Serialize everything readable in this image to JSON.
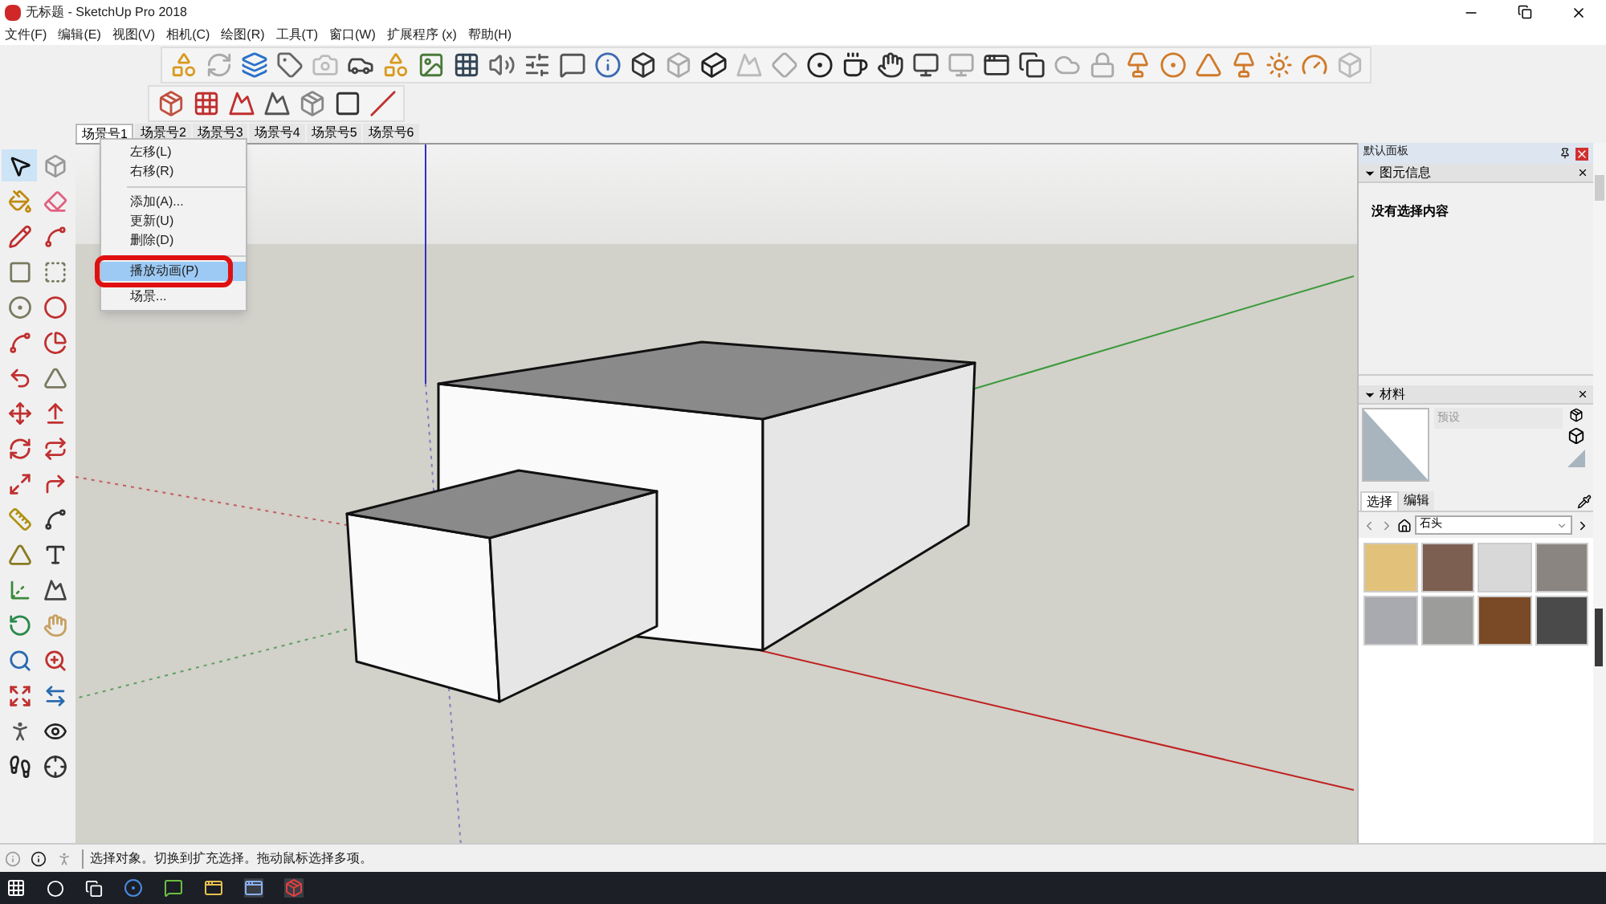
{
  "window": {
    "title": "无标题 - SketchUp Pro 2018"
  },
  "menu_bar": [
    "文件(F)",
    "编辑(E)",
    "视图(V)",
    "相机(C)",
    "绘图(R)",
    "工具(T)",
    "窗口(W)",
    "扩展程序 (x)",
    "帮助(H)"
  ],
  "scene_tabs": [
    {
      "label": "场景号1",
      "selected": true
    },
    {
      "label": "场景号2",
      "selected": false
    },
    {
      "label": "场景号3",
      "selected": false
    },
    {
      "label": "场景号4",
      "selected": false
    },
    {
      "label": "场景号5",
      "selected": false
    },
    {
      "label": "场景号6",
      "selected": false
    }
  ],
  "context_menu": {
    "items": [
      {
        "kind": "item",
        "label": "左移(L)",
        "highlighted": false
      },
      {
        "kind": "item",
        "label": "右移(R)",
        "highlighted": false
      },
      {
        "kind": "separator"
      },
      {
        "kind": "item",
        "label": "添加(A)...",
        "highlighted": false
      },
      {
        "kind": "item",
        "label": "更新(U)",
        "highlighted": false
      },
      {
        "kind": "item",
        "label": "删除(D)",
        "highlighted": false
      },
      {
        "kind": "separator"
      },
      {
        "kind": "item",
        "label": "播放动画(P)",
        "highlighted": true
      },
      {
        "kind": "item",
        "label": "场景...",
        "highlighted": false
      }
    ]
  },
  "tools": [
    {
      "selected": true
    },
    {
      "selected": false
    },
    {
      "selected": false
    },
    {
      "selected": false
    },
    {
      "selected": false
    },
    {
      "selected": false
    },
    {
      "selected": false
    },
    {
      "selected": false
    },
    {
      "selected": false
    },
    {
      "selected": false
    },
    {
      "selected": false
    },
    {
      "selected": false
    },
    {
      "selected": false
    },
    {
      "selected": false
    },
    {
      "selected": false
    },
    {
      "selected": false
    },
    {
      "selected": false
    },
    {
      "selected": false
    },
    {
      "selected": false
    },
    {
      "selected": false
    },
    {
      "selected": false
    },
    {
      "selected": false
    },
    {
      "selected": false
    },
    {
      "selected": false
    },
    {
      "selected": false
    },
    {
      "selected": false
    },
    {
      "selected": false
    },
    {
      "selected": false
    },
    {
      "selected": false
    },
    {
      "selected": false
    },
    {
      "selected": false
    },
    {
      "selected": false
    },
    {
      "selected": false
    },
    {
      "selected": false
    },
    {
      "selected": false
    },
    {
      "selected": false
    }
  ],
  "tray": {
    "title": "默认面板",
    "entity_info": {
      "title": "图元信息",
      "expanded": true,
      "text": "没有选择内容"
    },
    "materials": {
      "title": "材料",
      "expanded": true,
      "name_placeholder": "预设",
      "tabs": [
        {
          "label": "选择",
          "selected": true
        },
        {
          "label": "编辑",
          "selected": false
        }
      ],
      "collection": "石头",
      "swatches": [
        {
          "color": "#e2c27a"
        },
        {
          "color": "#7d5f52"
        },
        {
          "color": "#d8d8d8"
        },
        {
          "color": "#8a8580"
        },
        {
          "color": "#a9aab0"
        },
        {
          "color": "#9c9c9a"
        },
        {
          "color": "#7a4a26"
        },
        {
          "color": "#4a4a4a"
        }
      ]
    }
  },
  "status_bar": {
    "text": "选择对象。切换到扩充选择。拖动鼠标选择多项。"
  }
}
